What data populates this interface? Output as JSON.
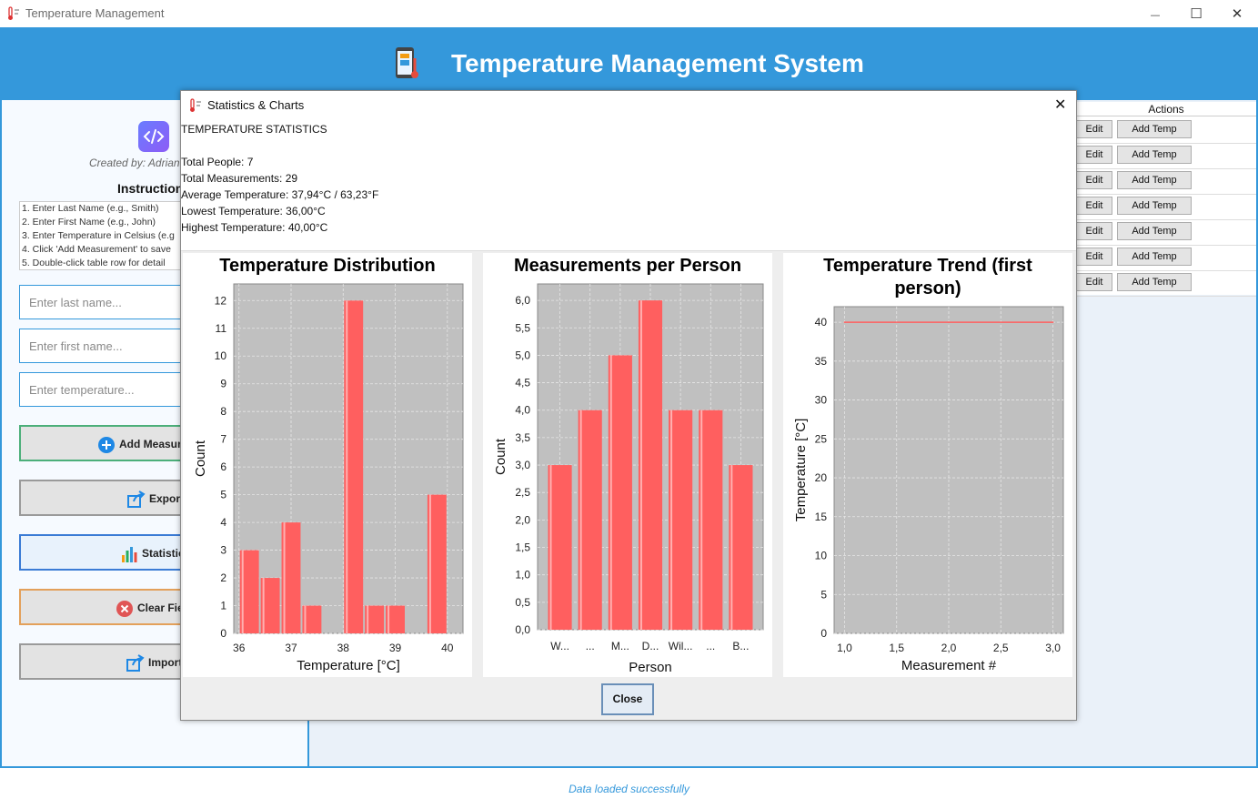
{
  "window": {
    "title": "Temperature Management",
    "controls": {
      "minimize": "—",
      "maximize": "☐",
      "close": "✕"
    }
  },
  "header": {
    "title": "Temperature Management System"
  },
  "sidebar": {
    "created_by": "Created by: Adrian",
    "instructions_title": "Instructions",
    "instructions": [
      "1. Enter Last Name (e.g., Smith)",
      "2. Enter First Name (e.g., John)",
      "3. Enter Temperature in Celsius (e.g",
      "4. Click 'Add Measurement' to save",
      "5. Double-click table row for detail"
    ],
    "inputs": {
      "last_name_placeholder": "Enter last name...",
      "first_name_placeholder": "Enter first name...",
      "temperature_placeholder": "Enter temperature..."
    },
    "buttons": {
      "add": "Add Measure",
      "export": "Export",
      "statistics": "Statistic",
      "clear": "Clear Fiel",
      "import": "Import"
    }
  },
  "table": {
    "actions_header": "Actions",
    "rows": [
      {
        "edit": "Edit",
        "add_temp": "Add Temp"
      },
      {
        "edit": "Edit",
        "add_temp": "Add Temp"
      },
      {
        "edit": "Edit",
        "add_temp": "Add Temp"
      },
      {
        "edit": "Edit",
        "add_temp": "Add Temp"
      },
      {
        "edit": "Edit",
        "add_temp": "Add Temp"
      },
      {
        "edit": "Edit",
        "add_temp": "Add Temp"
      },
      {
        "edit": "Edit",
        "add_temp": "Add Temp"
      }
    ]
  },
  "status": "Data loaded successfully",
  "dialog": {
    "title": "Statistics & Charts",
    "close_icon": "✕",
    "stats": {
      "heading": "TEMPERATURE STATISTICS",
      "total_people": "Total People: 7",
      "total_measurements": "Total Measurements: 29",
      "average": "Average Temperature: 37,94°C / 63,23°F",
      "lowest": "Lowest Temperature: 36,00°C",
      "highest": "Highest Temperature: 40,00°C"
    },
    "close_button": "Close"
  },
  "colors": {
    "header_blue": "#3498db",
    "bar_red": "#ff5f5f",
    "plot_bg": "#c0c0c0",
    "stats_button_bg": "#e8f2fc"
  },
  "icons": {
    "app": "thermometer-phone-icon",
    "add": "plus-circle-icon",
    "export": "export-icon",
    "statistics": "bar-chart-icon",
    "clear": "x-circle-icon",
    "import": "import-icon",
    "logo": "code-icon"
  },
  "chart_data": [
    {
      "type": "bar",
      "title": "Temperature Distribution",
      "xlabel": "Temperature [°C]",
      "ylabel": "Count",
      "xlim": [
        35.9,
        40.3
      ],
      "ylim": [
        0,
        12.6
      ],
      "xticks": [
        "36",
        "37",
        "38",
        "39",
        "40"
      ],
      "yticks": [
        "0",
        "1",
        "2",
        "3",
        "4",
        "5",
        "6",
        "7",
        "8",
        "9",
        "10",
        "11",
        "12"
      ],
      "bins": [
        {
          "from": 36.0,
          "to": 36.4,
          "count": 3
        },
        {
          "from": 36.4,
          "to": 36.8,
          "count": 2
        },
        {
          "from": 36.8,
          "to": 37.2,
          "count": 4
        },
        {
          "from": 37.2,
          "to": 37.6,
          "count": 1
        },
        {
          "from": 38.0,
          "to": 38.4,
          "count": 12
        },
        {
          "from": 38.4,
          "to": 38.8,
          "count": 1
        },
        {
          "from": 38.8,
          "to": 39.2,
          "count": 1
        },
        {
          "from": 39.6,
          "to": 40.0,
          "count": 5
        }
      ],
      "grid": true
    },
    {
      "type": "bar",
      "title": "Measurements per Person",
      "xlabel": "Person",
      "ylabel": "Count",
      "ylim": [
        0,
        6.3
      ],
      "yticks": [
        "0,0",
        "0,5",
        "1,0",
        "1,5",
        "2,0",
        "2,5",
        "3,0",
        "3,5",
        "4,0",
        "4,5",
        "5,0",
        "5,5",
        "6,0"
      ],
      "categories": [
        "W...",
        "...",
        "M...",
        "D...",
        "Wil...",
        "...",
        "B..."
      ],
      "values": [
        3,
        4,
        5,
        6,
        4,
        4,
        3
      ],
      "grid": true
    },
    {
      "type": "line",
      "title": "Temperature Trend (first person)",
      "xlabel": "Measurement #",
      "ylabel": "Temperature [°C]",
      "xlim": [
        0.9,
        3.1
      ],
      "ylim": [
        0,
        42
      ],
      "xticks": [
        "1,0",
        "1,5",
        "2,0",
        "2,5",
        "3,0"
      ],
      "yticks": [
        "0",
        "5",
        "10",
        "15",
        "20",
        "25",
        "30",
        "35",
        "40"
      ],
      "x": [
        1,
        2,
        3
      ],
      "y": [
        40,
        40,
        40
      ],
      "grid": true
    }
  ]
}
